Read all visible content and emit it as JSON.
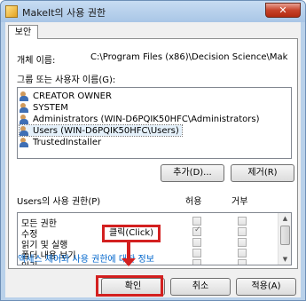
{
  "window": {
    "title": "MakeIt의 사용 권한",
    "close_label": "✕"
  },
  "tabs": [
    {
      "label": "보안"
    }
  ],
  "object": {
    "label": "개체 이름:",
    "value": "C:\\Program Files (x86)\\Decision Science\\Mak"
  },
  "group_list": {
    "label": "그룹 또는 사용자 이름(G):",
    "items": [
      {
        "label": "CREATOR OWNER",
        "icon": "user-group-icon"
      },
      {
        "label": "SYSTEM",
        "icon": "user-group-icon"
      },
      {
        "label": "Administrators (WIN-D6PQIK50HFC\\Administrators)",
        "icon": "user-group-icon"
      },
      {
        "label": "Users (WIN-D6PQIK50HFC\\Users)",
        "icon": "user-group-icon",
        "selected": true
      },
      {
        "label": "TrustedInstaller",
        "icon": "user-group-icon"
      }
    ]
  },
  "buttons": {
    "add": "추가(D)...",
    "remove": "제거(R)",
    "ok": "확인",
    "cancel": "취소",
    "apply": "적용(A)"
  },
  "permissions": {
    "label": "Users의 사용 권한(P)",
    "allow_header": "허용",
    "deny_header": "거부",
    "rows": [
      {
        "name": "모든 권한",
        "allow": false,
        "deny": false
      },
      {
        "name": "수정",
        "allow": true,
        "deny": false
      },
      {
        "name": "읽기 및 실행",
        "allow": false,
        "deny": false
      },
      {
        "name": "폴더 내용 보기",
        "allow": false,
        "deny": false
      },
      {
        "name": "읽기",
        "allow": false,
        "deny": false
      }
    ]
  },
  "link": {
    "label": "액세스 제어와 사용 권한에 대한 정보"
  },
  "annotation": {
    "callout": "클릭(Click)",
    "color": "#d32020"
  }
}
